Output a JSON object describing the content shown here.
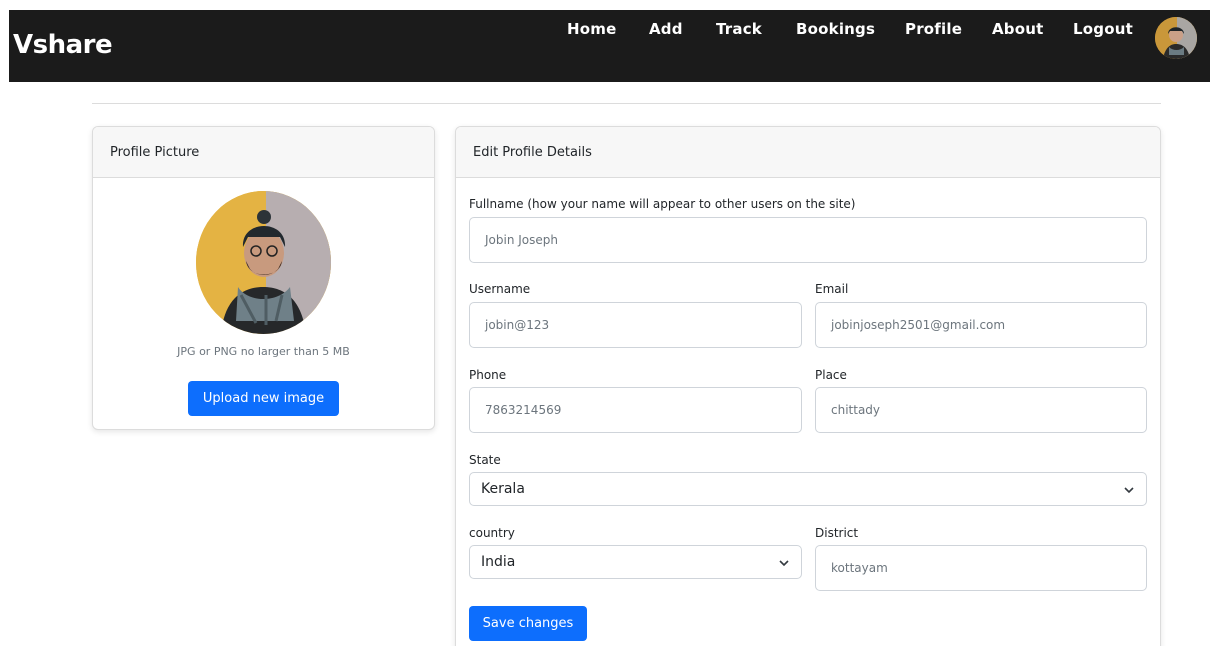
{
  "nav": {
    "brand": "Vshare",
    "links": [
      "Home",
      "Add",
      "Track",
      "Bookings",
      "Profile",
      "About",
      "Logout"
    ],
    "avatar_icon": "user-avatar"
  },
  "profile_picture": {
    "header": "Profile Picture",
    "hint": "JPG or PNG no larger than 5 MB",
    "upload_label": "Upload new image"
  },
  "edit_profile": {
    "header": "Edit Profile Details",
    "fullname": {
      "label": "Fullname (how your name will appear to other users on the site)",
      "value": "Jobin Joseph"
    },
    "username": {
      "label": "Username",
      "value": "jobin@123"
    },
    "email": {
      "label": "Email",
      "value": "jobinjoseph2501@gmail.com"
    },
    "phone": {
      "label": "Phone",
      "value": "7863214569"
    },
    "place": {
      "label": "Place",
      "value": "chittady"
    },
    "state": {
      "label": "State",
      "selected": "Kerala"
    },
    "country": {
      "label": "country",
      "selected": "India"
    },
    "district": {
      "label": "District",
      "value": "kottayam"
    },
    "save_label": "Save changes"
  },
  "colors": {
    "navbar": "#1b1b1b",
    "primary": "#0d6efd",
    "card_header": "#f7f7f7"
  }
}
